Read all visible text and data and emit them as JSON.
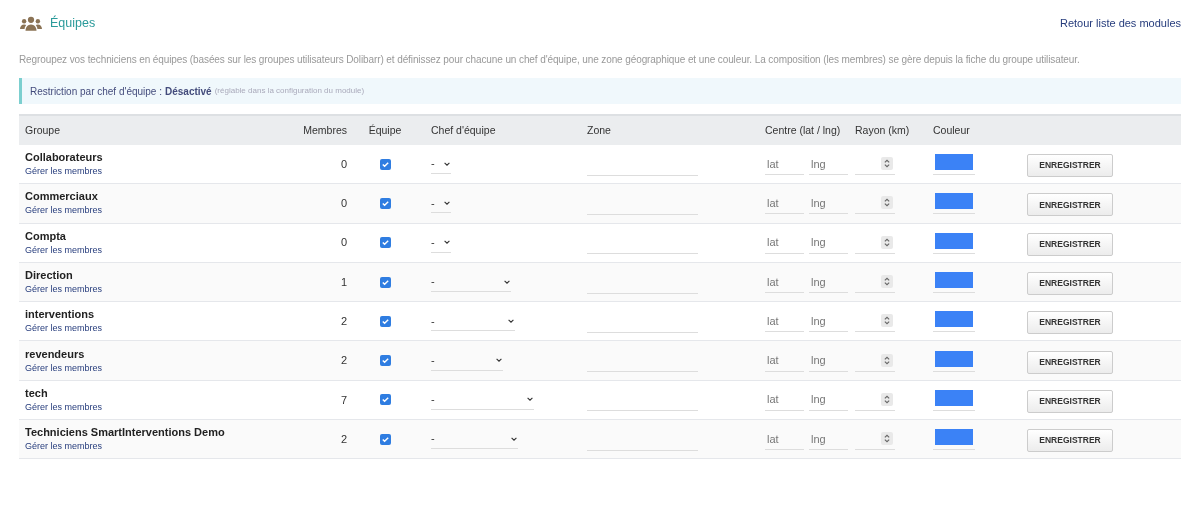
{
  "title": "Équipes",
  "back_link": "Retour liste des modules",
  "description": "Regroupez vos techniciens en équipes (basées sur les groupes utilisateurs Dolibarr) et définissez pour chacune un chef d'équipe, une zone géographique et une couleur. La composition (les membres) se gère depuis la fiche du groupe utilisateur.",
  "notice": {
    "label": "Restriction par chef d'équipe :",
    "value": "Désactivé",
    "hint": "(réglable dans la configuration du module)"
  },
  "table": {
    "columns": [
      "Groupe",
      "Membres",
      "Équipe",
      "Chef d'équipe",
      "Zone",
      "Centre (lat / lng)",
      "Rayon (km)",
      "Couleur"
    ],
    "rows": [
      {
        "name": "Collaborateurs",
        "link": "Gérer les membres",
        "members": "0",
        "team": true,
        "chef": "-",
        "lat_placeholder": "lat",
        "lng_placeholder": "lng",
        "color": "#3b82f6",
        "button": "ENREGISTRER"
      },
      {
        "name": "Commerciaux",
        "link": "Gérer les membres",
        "members": "0",
        "team": true,
        "chef": "-",
        "lat_placeholder": "lat",
        "lng_placeholder": "lng",
        "color": "#3b82f6",
        "button": "ENREGISTRER"
      },
      {
        "name": "Compta",
        "link": "Gérer les membres",
        "members": "0",
        "team": true,
        "chef": "-",
        "lat_placeholder": "lat",
        "lng_placeholder": "lng",
        "color": "#3b82f6",
        "button": "ENREGISTRER"
      },
      {
        "name": "Direction",
        "link": "Gérer les membres",
        "members": "1",
        "team": true,
        "chef": "-",
        "lat_placeholder": "lat",
        "lng_placeholder": "lng",
        "color": "#3b82f6",
        "button": "ENREGISTRER"
      },
      {
        "name": "interventions",
        "link": "Gérer les membres",
        "members": "2",
        "team": true,
        "chef": "-",
        "lat_placeholder": "lat",
        "lng_placeholder": "lng",
        "color": "#3b82f6",
        "button": "ENREGISTRER"
      },
      {
        "name": "revendeurs",
        "link": "Gérer les membres",
        "members": "2",
        "team": true,
        "chef": "-",
        "lat_placeholder": "lat",
        "lng_placeholder": "lng",
        "color": "#3b82f6",
        "button": "ENREGISTRER"
      },
      {
        "name": "tech",
        "link": "Gérer les membres",
        "members": "7",
        "team": true,
        "chef": "-",
        "lat_placeholder": "lat",
        "lng_placeholder": "lng",
        "color": "#3b82f6",
        "button": "ENREGISTRER"
      },
      {
        "name": "Techniciens SmartInterventions Demo",
        "link": "Gérer les membres",
        "members": "2",
        "team": true,
        "chef": "-",
        "lat_placeholder": "lat",
        "lng_placeholder": "lng",
        "color": "#3b82f6",
        "button": "ENREGISTRER"
      }
    ]
  }
}
